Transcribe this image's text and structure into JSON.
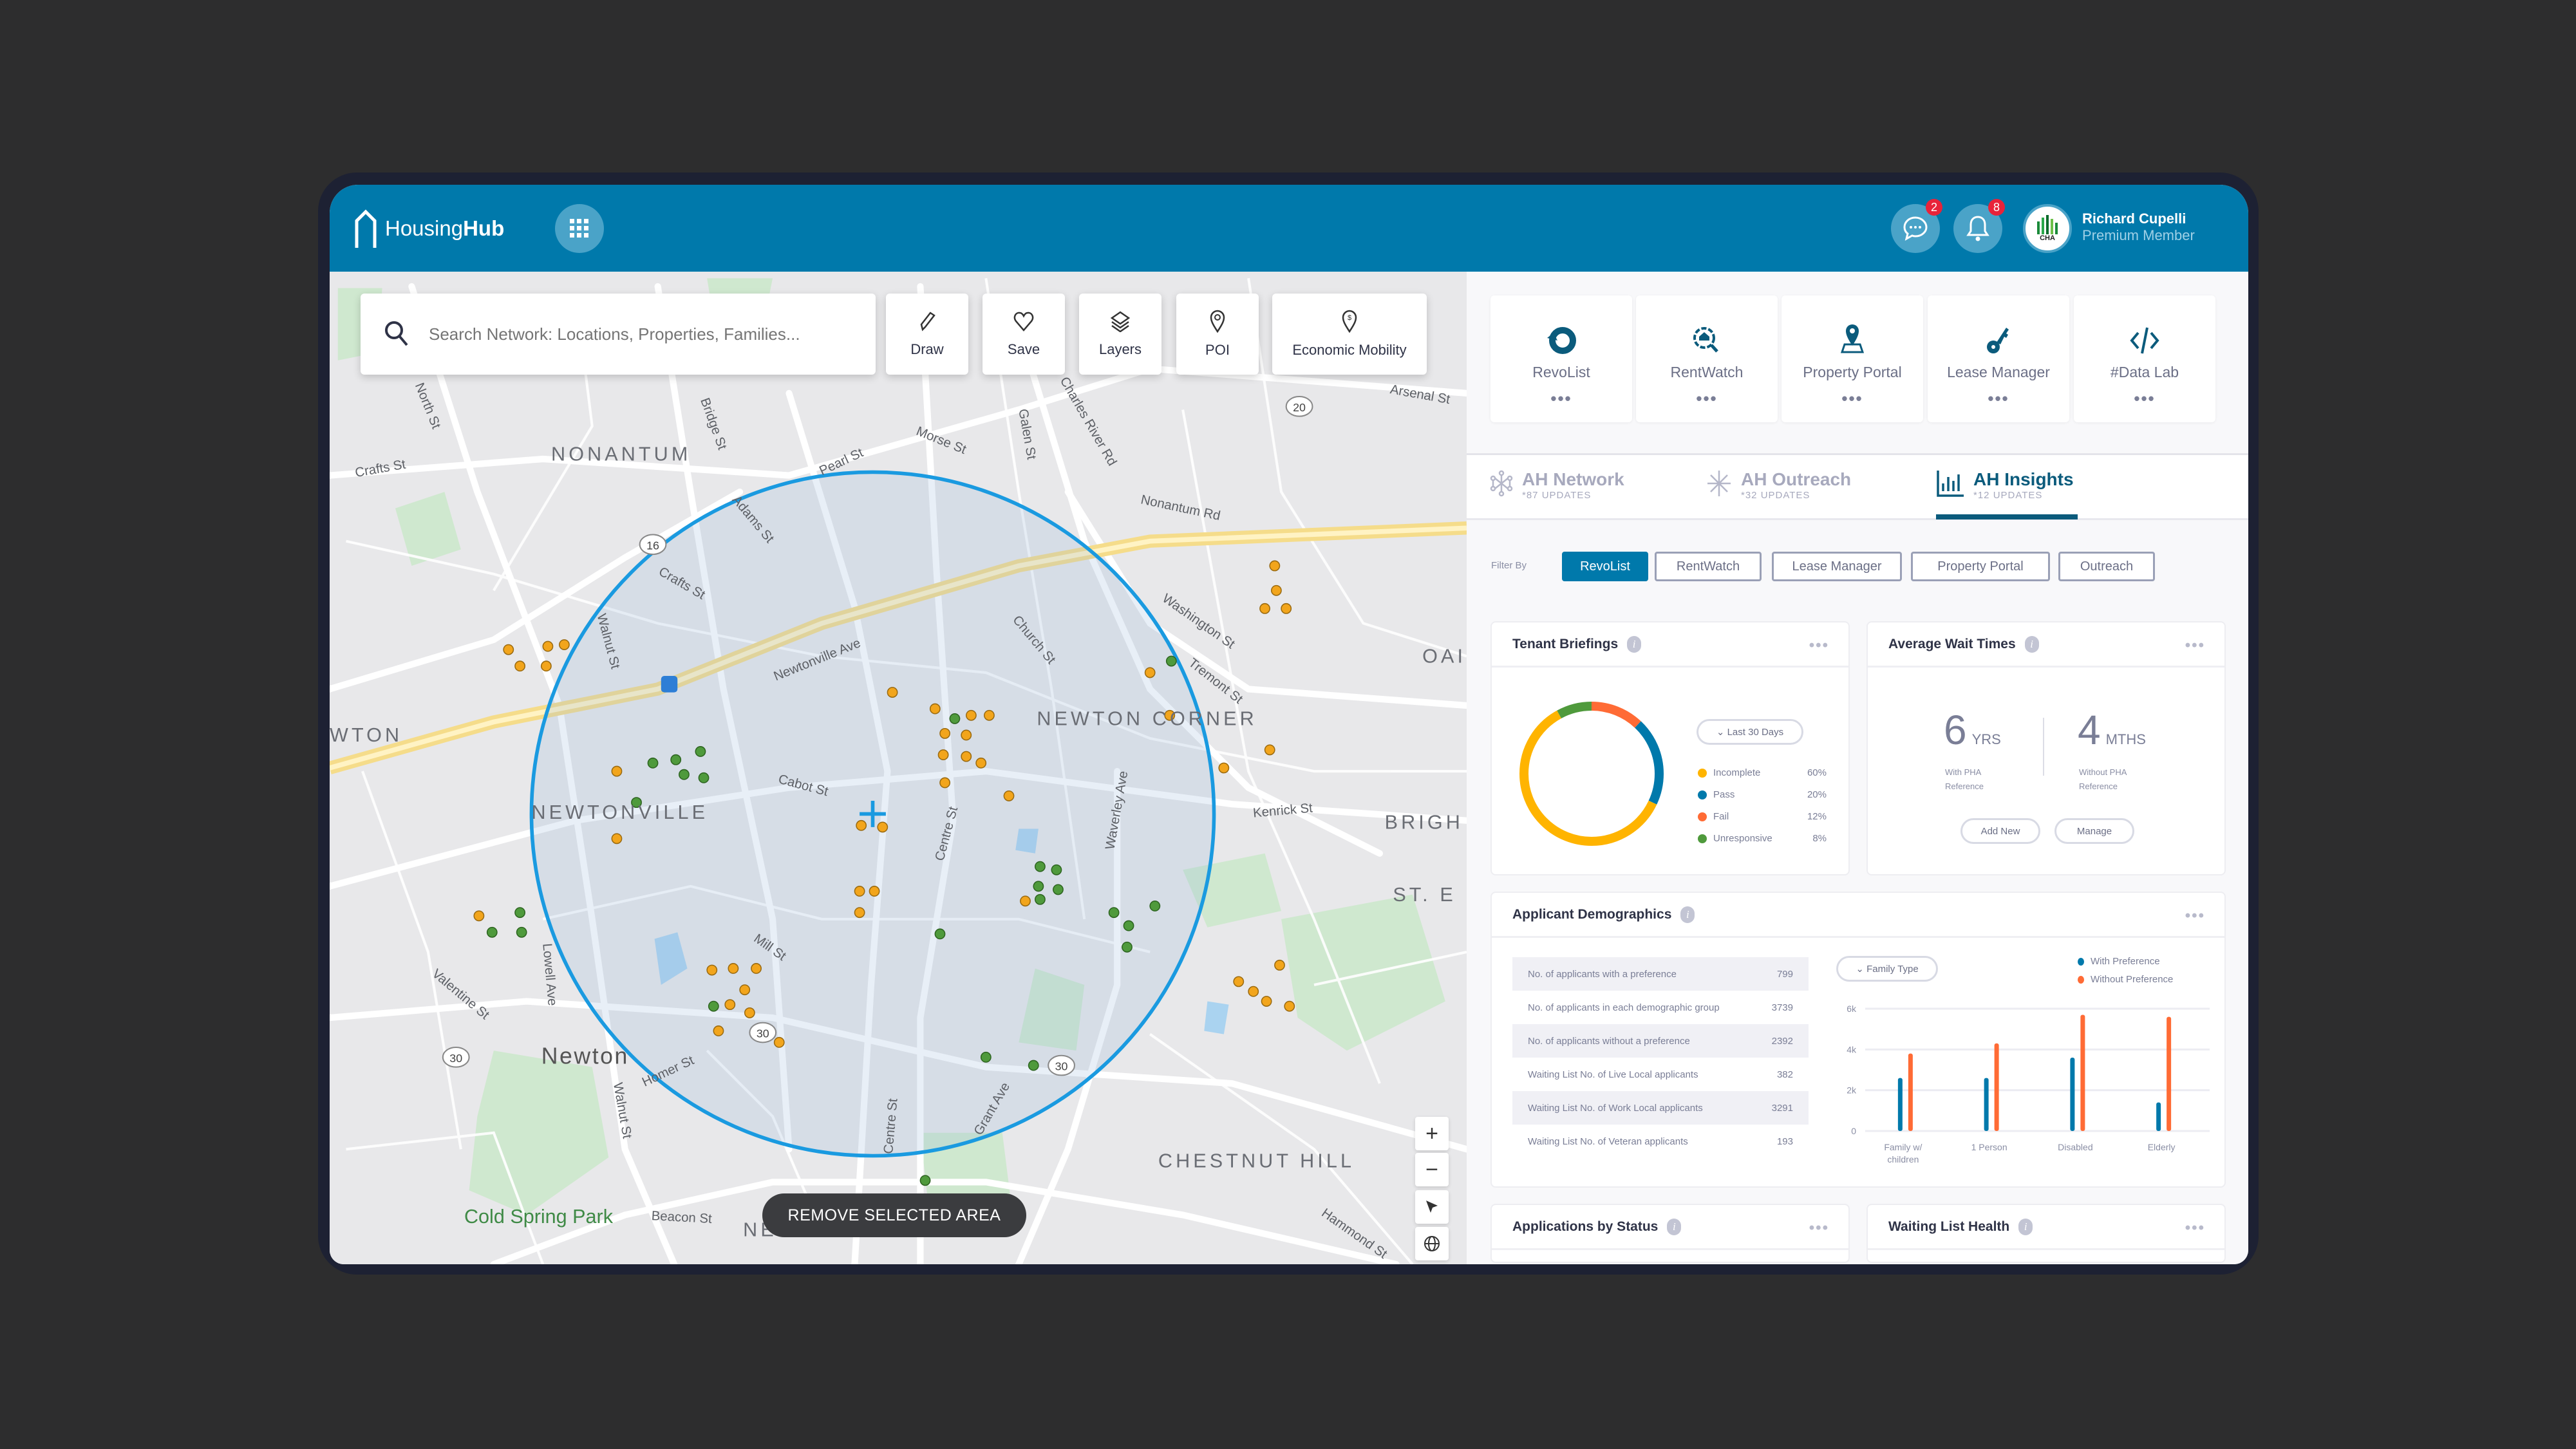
{
  "app": {
    "brand_light": "Housing",
    "brand_bold": "Hub"
  },
  "header": {
    "messages_badge": "2",
    "notifications_badge": "8",
    "avatar_text": "CHA",
    "user_name": "Richard Cupelli",
    "user_role": "Premium Member"
  },
  "map": {
    "search_placeholder": "Search Network: Locations, Properties, Families...",
    "tools": [
      "Draw",
      "Save",
      "Layers",
      "POI",
      "Economic Mobility"
    ],
    "remove_area": "REMOVE SELECTED AREA",
    "controls": {
      "zoom_in": "+",
      "zoom_out": "−"
    },
    "places": {
      "nonantum": "NONANTUM",
      "newtonville": "NEWTONVILLE",
      "newton_corner": "NEWTON CORNER",
      "newton": "Newton",
      "chestnut_hill": "CHESTNUT HILL",
      "brighton": "BRIGH",
      "st_e": "ST. E",
      "oak": "OAI",
      "wton": "WTON",
      "cold_spring": "Cold Spring Park",
      "nbsp": "NE"
    },
    "streets": {
      "crafts1": "Crafts St",
      "crafts2": "Crafts St",
      "walnut": "Walnut St",
      "newtonville_ave": "Newtonville Ave",
      "cabot": "Cabot St",
      "church": "Church St",
      "centre": "Centre St",
      "centre2": "Centre St",
      "waverley": "Waverley Ave",
      "washington": "Washington St",
      "tremont": "Tremont St",
      "kenrick": "Kenrick St",
      "nonantum_rd": "Nonantum Rd",
      "arsenal": "Arsenal St",
      "charles": "Charles River Rd",
      "galen": "Galen St",
      "morse": "Morse St",
      "pearl": "Pearl St",
      "adams": "Adams St",
      "bridge": "Bridge St",
      "north": "North St",
      "mill": "Mill St",
      "lowell": "Lowell Ave",
      "valentine": "Valentine St",
      "homer": "Homer St",
      "beacon": "Beacon St",
      "grant": "Grant Ave",
      "hammond": "Hammond St",
      "walnut2": "Walnut St",
      "rt16": "16",
      "rt20": "20",
      "rt30a": "30",
      "rt30b": "30",
      "rt30c": "30"
    }
  },
  "apps": [
    {
      "label": "RevoList"
    },
    {
      "label": "RentWatch"
    },
    {
      "label": "Property Portal"
    },
    {
      "label": "Lease Manager"
    },
    {
      "label": "#Data Lab"
    }
  ],
  "tabs": [
    {
      "label": "AH Network",
      "updates": "*87  UPDATES"
    },
    {
      "label": "AH Outreach",
      "updates": "*32  UPDATES"
    },
    {
      "label": "AH Insights",
      "updates": "*12  UPDATES"
    }
  ],
  "active_tab": "AH Insights",
  "filter": {
    "label": "Filter By",
    "options": [
      "RevoList",
      "RentWatch",
      "Lease Manager",
      "Property Portal",
      "Outreach"
    ],
    "selected": "RevoList"
  },
  "tenant_briefings": {
    "title": "Tenant Briefings",
    "range": "Last 30 Days",
    "items": [
      {
        "label": "Incomplete",
        "value": "60%",
        "pct": 60,
        "color": "#ffb400"
      },
      {
        "label": "Pass",
        "value": "20%",
        "pct": 20,
        "color": "#0079ab"
      },
      {
        "label": "Fail",
        "value": "12%",
        "pct": 12,
        "color": "#ff6b35"
      },
      {
        "label": "Unresponsive",
        "value": "8%",
        "pct": 8,
        "color": "#4f9a3c"
      }
    ]
  },
  "wait_times": {
    "title": "Average Wait Times",
    "a_value": "6",
    "a_unit": "YRS",
    "a_caption1": "With PHA",
    "a_caption2": "Reference",
    "b_value": "4",
    "b_unit": "MTHS",
    "b_caption1": "Without PHA",
    "b_caption2": "Reference",
    "add_new": "Add New",
    "manage": "Manage"
  },
  "demographics": {
    "title": "Applicant Demographics",
    "rows": [
      {
        "label": "No. of applicants with a preference",
        "value": "799"
      },
      {
        "label": "No. of applicants in each demographic group",
        "value": "3739"
      },
      {
        "label": "No. of applicants without a preference",
        "value": "2392"
      },
      {
        "label": "Waiting List No. of Live Local applicants",
        "value": "382"
      },
      {
        "label": "Waiting List No. of Work Local applicants",
        "value": "3291"
      },
      {
        "label": "Waiting List No. of Veteran  applicants",
        "value": "193"
      }
    ],
    "dropdown": "Family Type"
  },
  "chart_data": {
    "type": "bar",
    "title": "Applicant Demographics",
    "categories": [
      "Family w/ children",
      "1 Person",
      "Disabled",
      "Elderly"
    ],
    "series": [
      {
        "name": "With Preference",
        "color": "#0079ab",
        "values": [
          2600,
          2600,
          3600,
          1400
        ]
      },
      {
        "name": "Without Preference",
        "color": "#ff6b35",
        "values": [
          3800,
          4300,
          5700,
          5600
        ]
      }
    ],
    "yticks": [
      "0",
      "2k",
      "4k",
      "6k"
    ],
    "ylim": [
      0,
      6000
    ],
    "legend": "top-right",
    "grid": true
  },
  "bottom_cards": {
    "status_title": "Applications by Status",
    "health_title": "Waiting List Health"
  }
}
